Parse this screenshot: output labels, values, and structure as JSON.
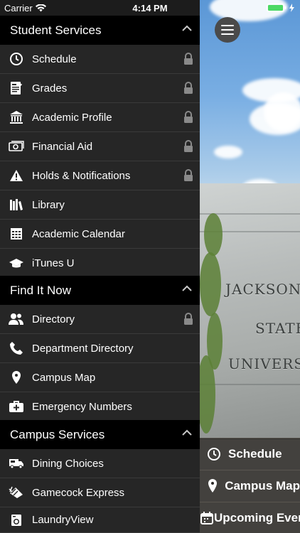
{
  "status_bar": {
    "carrier": "Carrier",
    "time": "4:14 PM",
    "wifi_icon": "wifi-icon",
    "battery_icon": "battery-icon",
    "battery_color": "#4cd964"
  },
  "menu_button": {
    "icon": "hamburger-menu-icon"
  },
  "background_photo": {
    "carved_text": [
      "JACKSONVI",
      "STATE",
      "UNIVERSIT"
    ]
  },
  "sections": [
    {
      "title": "Student Services",
      "items": [
        {
          "label": "Schedule",
          "icon": "clock-icon",
          "locked": true
        },
        {
          "label": "Grades",
          "icon": "report-icon",
          "locked": true
        },
        {
          "label": "Academic Profile",
          "icon": "institution-icon",
          "locked": true
        },
        {
          "label": "Financial Aid",
          "icon": "money-icon",
          "locked": true
        },
        {
          "label": "Holds & Notifications",
          "icon": "warning-icon",
          "locked": true
        },
        {
          "label": "Library",
          "icon": "books-icon",
          "locked": false
        },
        {
          "label": "Academic Calendar",
          "icon": "calendar-grid-icon",
          "locked": false
        },
        {
          "label": "iTunes U",
          "icon": "graduation-cap-icon",
          "locked": false
        }
      ]
    },
    {
      "title": "Find It Now",
      "items": [
        {
          "label": "Directory",
          "icon": "people-icon",
          "locked": true
        },
        {
          "label": "Department Directory",
          "icon": "phone-icon",
          "locked": false
        },
        {
          "label": "Campus Map",
          "icon": "map-pin-icon",
          "locked": false
        },
        {
          "label": "Emergency Numbers",
          "icon": "first-aid-kit-icon",
          "locked": false
        }
      ]
    },
    {
      "title": "Campus Services",
      "items": [
        {
          "label": "Dining Choices",
          "icon": "food-truck-icon",
          "locked": false
        },
        {
          "label": "Gamecock Express",
          "icon": "card-icon",
          "locked": false
        },
        {
          "label": "LaundryView",
          "icon": "washer-icon",
          "locked": false
        }
      ]
    }
  ],
  "quick_links": [
    {
      "label": "Schedule",
      "icon": "clock-icon"
    },
    {
      "label": "Campus Map",
      "icon": "map-pin-icon"
    },
    {
      "label": "Upcoming Events",
      "icon": "calendar-icon"
    }
  ],
  "colors": {
    "drawer_bg": "#262626",
    "header_bg": "#000000",
    "lock_color": "#8a8a8a"
  }
}
